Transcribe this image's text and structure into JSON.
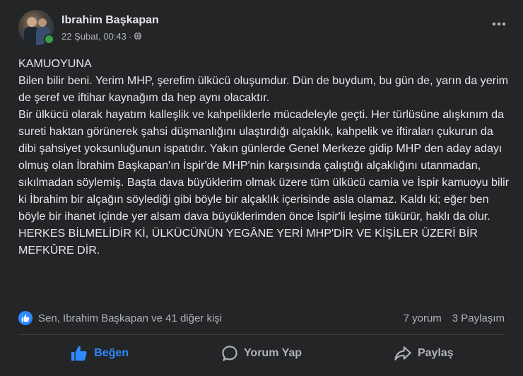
{
  "post": {
    "author": "Ibrahim Başkapan",
    "timestamp": "22 Şubat, 00:43",
    "separator": "·",
    "privacy_icon": "globe-icon",
    "more_icon": "more-horizontal-icon",
    "lines": [
      "KAMUOYUNA",
      "Bilen bilir beni. Yerim MHP, şerefim ülkücü oluşumdur. Dün de buydum, bu gün de, yarın da yerim de şeref ve iftihar kaynağım da hep aynı olacaktır.",
      "Bir ülkücü olarak hayatım kalleşlik ve kahpeliklerle mücadeleyle geçti. Her türlüsüne alışkınım da sureti haktan görünerek şahsi düşmanlığını ulaştırdığı alçaklık, kahpelik ve iftiraları çukurun da dibi şahsiyet yoksunluğunun ispatıdır. Yakın günlerde Genel Merkeze gidip MHP den aday adayı olmuş olan İbrahim Başkapan'ın İspir'de MHP'nin karşısında çalıştığı alçaklığını utanmadan, sıkılmadan söylemiş. Başta dava büyüklerim olmak üzere tüm ülkücü camia ve İspir kamuoyu bilir ki İbrahim bir alçağın söylediği gibi böyle bir alçaklık içerisinde asla olamaz. Kaldı ki; eğer ben böyle bir ihanet içinde yer alsam dava büyüklerimden önce İspir'li leşime tükürür, haklı da olur.",
      "HERKES BİLMELİDİR Kİ, ÜLKÜCÜNÜN YEGÂNE YERİ MHP'DİR VE KİŞİLER ÜZERİ BİR MEFKÛRE DİR."
    ]
  },
  "stats": {
    "reactions_text": "Sen, Ibrahim Başkapan ve 41 diğer kişi",
    "comments": "7 yorum",
    "shares": "3 Paylaşım"
  },
  "actions": {
    "like": "Beğen",
    "comment": "Yorum Yap",
    "share": "Paylaş"
  },
  "colors": {
    "background": "#242526",
    "accent": "#2e89ff",
    "online": "#31a24c"
  }
}
